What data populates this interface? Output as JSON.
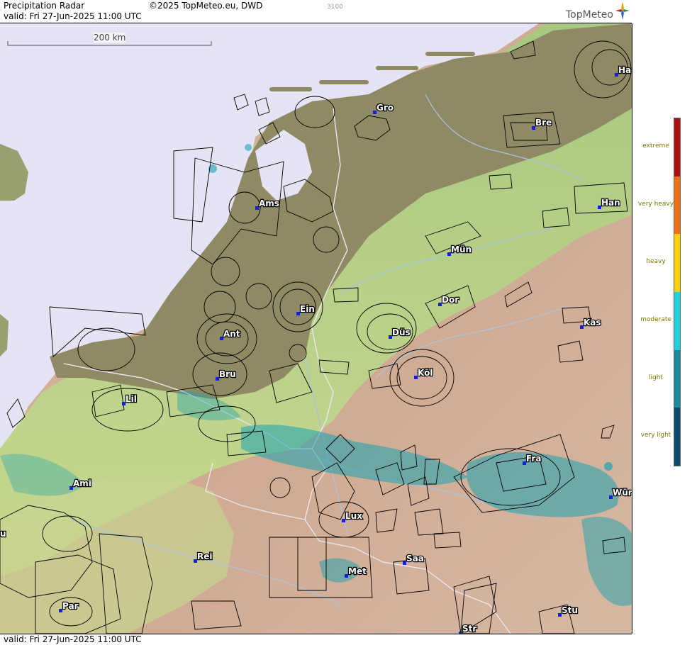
{
  "header": {
    "title": "Precipitation Radar",
    "copyright": "©2025 TopMeteo.eu, DWD",
    "code": "3100",
    "valid": "valid:  Fri  27-Jun-2025 11:00 UTC",
    "logo": "TopMeteo"
  },
  "footer": {
    "valid": "valid:  Fri  27-Jun-2025 11:00 UTC"
  },
  "scale": {
    "label": "200 km"
  },
  "legend": {
    "levels": [
      {
        "label": "extreme",
        "color": "#b01010"
      },
      {
        "label": "very heavy",
        "color": "#f07010"
      },
      {
        "label": "heavy",
        "color": "#ffd000"
      },
      {
        "label": "moderate",
        "color": "#20d0d8"
      },
      {
        "label": "light",
        "color": "#1a8aa0"
      },
      {
        "label": "very light",
        "color": "#0b4a6a"
      }
    ]
  },
  "cities": [
    {
      "name": "Gro"
    },
    {
      "name": "Bre"
    },
    {
      "name": "Ha"
    },
    {
      "name": "Ams"
    },
    {
      "name": "Han"
    },
    {
      "name": "Mün"
    },
    {
      "name": "Dor"
    },
    {
      "name": "Ein"
    },
    {
      "name": "Kas"
    },
    {
      "name": "Ant"
    },
    {
      "name": "Düs"
    },
    {
      "name": "Bru"
    },
    {
      "name": "Köl"
    },
    {
      "name": "Lil"
    },
    {
      "name": "Fra"
    },
    {
      "name": "Ami"
    },
    {
      "name": "Wür"
    },
    {
      "name": "Lux"
    },
    {
      "name": "Rei"
    },
    {
      "name": "Saa"
    },
    {
      "name": "Met"
    },
    {
      "name": "Par"
    },
    {
      "name": "Stu"
    },
    {
      "name": "Str"
    },
    {
      "name": "u"
    }
  ],
  "colors": {
    "sea": "#e4e4f4",
    "lowland": "#8f8a64",
    "green": "#8fb86a",
    "relief": "#d2b4a0"
  }
}
